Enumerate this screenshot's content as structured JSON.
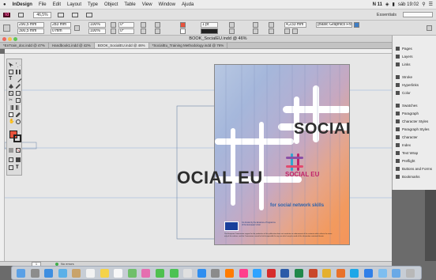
{
  "menubar": {
    "apple": "",
    "app_name": "InDesign",
    "items": [
      "File",
      "Edit",
      "Layout",
      "Type",
      "Object",
      "Table",
      "View",
      "Window",
      "Ajuda"
    ],
    "status_right": "N 11",
    "clock": "sáb 19:02"
  },
  "appbar": {
    "app_badge": "Id",
    "zoom": "46,5%",
    "workspace": "Essentials"
  },
  "controlbar": {
    "x_value": "290,5 mm",
    "y_value": "300,5 mm",
    "w_value": "283 mm",
    "h_value": "0 mm",
    "scale_x": "100%",
    "scale_y": "100%",
    "rotation": "0°",
    "shear": "0°",
    "stroke_weight": "1 pt",
    "spacing_value": "4,233 mm",
    "frame_style": "[Basic Graphics Frame]"
  },
  "document": {
    "title": "BOOK_SocialEU.indd @ 46%"
  },
  "tabs": [
    {
      "label": "*EnTrain_doc.indd @ 47%",
      "active": false
    },
    {
      "label": "Handbook1.indd @ 42%",
      "active": false
    },
    {
      "label": "BOOK_SocialEU.indd @ 46%",
      "active": true
    },
    {
      "label": "*SocialEu_Training Methodology.indd @ 76%",
      "active": false
    }
  ],
  "panel": {
    "items": [
      {
        "label": "Pages",
        "icon": "pages-icon"
      },
      {
        "label": "Layers",
        "icon": "layers-icon"
      },
      {
        "label": "Links",
        "icon": "links-icon"
      },
      {
        "label": "Stroke",
        "icon": "stroke-icon"
      },
      {
        "label": "Hyperlinks",
        "icon": "hyperlinks-icon"
      },
      {
        "label": "Color",
        "icon": "color-icon"
      },
      {
        "label": "Swatches",
        "icon": "swatches-icon"
      },
      {
        "label": "Paragraph",
        "icon": "paragraph-icon"
      },
      {
        "label": "Character Styles",
        "icon": "character-styles-icon"
      },
      {
        "label": "Paragraph Styles",
        "icon": "paragraph-styles-icon"
      },
      {
        "label": "Character",
        "icon": "character-icon"
      },
      {
        "label": "Index",
        "icon": "index-icon"
      },
      {
        "label": "Text Wrap",
        "icon": "text-wrap-icon"
      },
      {
        "label": "Preflight",
        "icon": "preflight-icon"
      },
      {
        "label": "Buttons and Forms",
        "icon": "buttons-forms-icon"
      },
      {
        "label": "Bookmarks",
        "icon": "bookmarks-icon"
      }
    ]
  },
  "canvas": {
    "headline_right": "SOCIAL EU",
    "headline_left": "OCIAL EU",
    "logo_text": "SOCIAL EU",
    "tagline": "for social network skills",
    "funding_text": "Co-funded by the Erasmus+ Programme of the European Union",
    "disclaimer": "The European Commission support for the production of this publication does not constitute an endorsement of the contents which reflects the views only of the authors, and the Commission cannot be held responsible for any use which may be made of the information contained therein."
  },
  "statusbar": {
    "page_number": "1",
    "preflight": "No errors"
  },
  "colors": {
    "accent_blue": "#2d63ad",
    "headline_dark": "#2d2d2d",
    "logo_magenta": "#c0236a",
    "logo_cyan": "#2ea6cf",
    "fill_swatch": "#e8533c"
  },
  "dock": {
    "apps": [
      "Finder",
      "Launchpad",
      "Safari",
      "Mail",
      "Contacts",
      "Calendar",
      "Notes",
      "Reminders",
      "Maps",
      "Photos",
      "Messages",
      "FaceTime",
      "iTunes",
      "App Store",
      "System Preferences",
      "Illustrator",
      "InDesign",
      "Photoshop",
      "Acrobat",
      "Word",
      "Excel",
      "PowerPoint",
      "Chrome",
      "Firefox",
      "Skype",
      "Dropbox",
      "Folder",
      "Downloads",
      "Trash"
    ]
  }
}
